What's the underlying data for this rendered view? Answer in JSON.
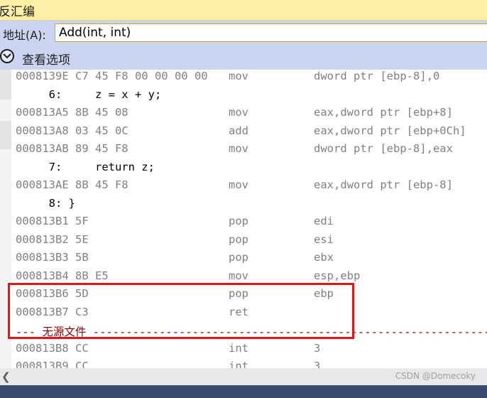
{
  "window": {
    "title": "反汇编"
  },
  "address": {
    "label": "地址(A):",
    "value": "Add(int, int)"
  },
  "view_options": {
    "label": "查看选项"
  },
  "lines": [
    {
      "addr": "0008139E C7 45 F8 00 00 00 00",
      "op": "mov",
      "args": "dword ptr [ebp-8],0"
    },
    {
      "source": "     6:     z = x + y;"
    },
    {
      "addr": "000813A5 8B 45 08",
      "op": "mov",
      "args": "eax,dword ptr [ebp+8]"
    },
    {
      "addr": "000813A8 03 45 0C",
      "op": "add",
      "args": "eax,dword ptr [ebp+0Ch]"
    },
    {
      "addr": "000813AB 89 45 F8",
      "op": "mov",
      "args": "dword ptr [ebp-8],eax"
    },
    {
      "source": "     7:     return z;"
    },
    {
      "addr": "000813AE 8B 45 F8",
      "op": "mov",
      "args": "eax,dword ptr [ebp-8]"
    },
    {
      "source": "     8: }"
    },
    {
      "addr": "000813B1 5F",
      "op": "pop",
      "args": "edi"
    },
    {
      "addr": "000813B2 5E",
      "op": "pop",
      "args": "esi"
    },
    {
      "addr": "000813B3 5B",
      "op": "pop",
      "args": "ebx"
    },
    {
      "addr": "000813B4 8B E5",
      "op": "mov",
      "args": "esp,ebp"
    },
    {
      "addr": "000813B6 5D",
      "op": "pop",
      "args": "ebp"
    },
    {
      "addr": "000813B7 C3",
      "op": "ret",
      "args": ""
    },
    {
      "nofile": "--- 无源文件 -----------------------------------------------------------------------"
    },
    {
      "addr": "000813B8 CC",
      "op": "int",
      "args": "3"
    },
    {
      "addr": "000813B9 CC",
      "op": "int",
      "args": "3"
    }
  ],
  "watermark": "CSDN @Domecoky",
  "colors": {
    "title_bg": "#fcefa6",
    "toolbar_bg": "#ccd5f0",
    "highlight_border": "#e3151a"
  },
  "icons": {
    "view_options_toggle": "chevron-down-icon",
    "scroll_left": "chevron-left-icon"
  }
}
